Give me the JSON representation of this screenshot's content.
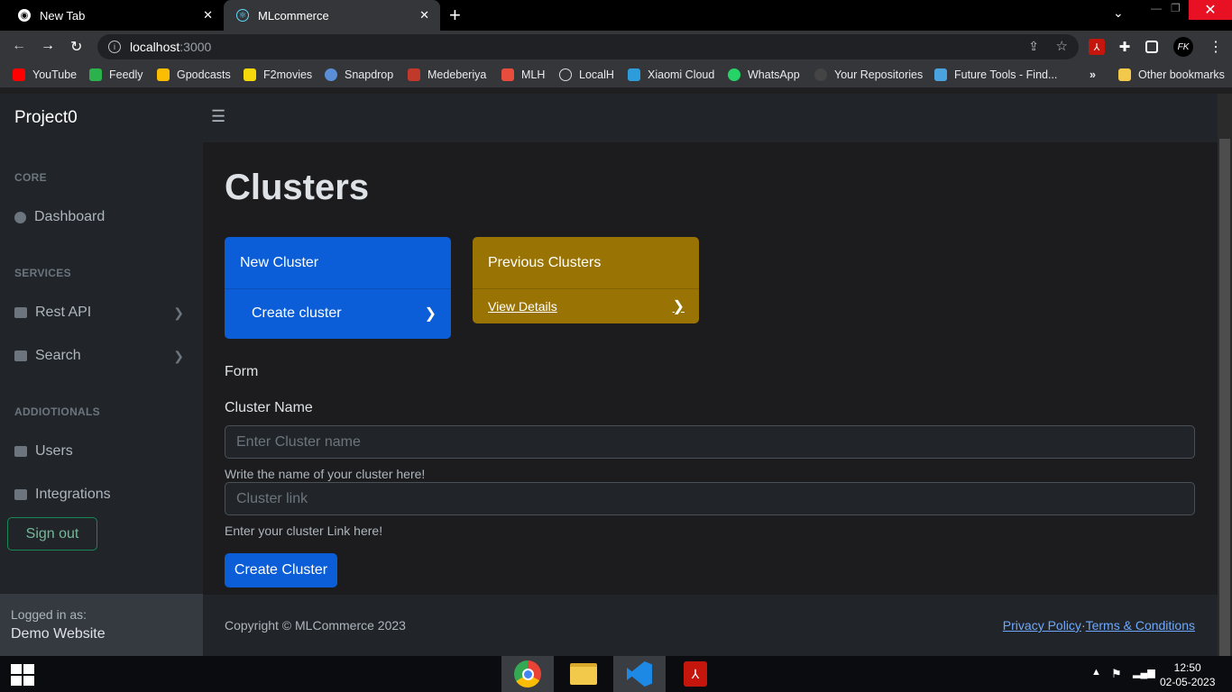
{
  "browser": {
    "tabs": [
      {
        "title": "New Tab"
      },
      {
        "title": "MLcommerce"
      }
    ],
    "address": {
      "host": "localhost",
      "port": ":3000"
    },
    "bookmarks": [
      {
        "label": "YouTube",
        "color": "#ff0000"
      },
      {
        "label": "Feedly",
        "color": "#2bb24c"
      },
      {
        "label": "Gpodcasts",
        "color": "#fbbc04"
      },
      {
        "label": "F2movies",
        "color": "#f5d90a"
      },
      {
        "label": "Snapdrop",
        "color": "#5a8fd8"
      },
      {
        "label": "Medeberiya",
        "color": "#c0392b"
      },
      {
        "label": "MLH",
        "color": "#e74c3c"
      },
      {
        "label": "LocalH",
        "color": "#dddddd"
      },
      {
        "label": "Xiaomi Cloud",
        "color": "#2d9cdb"
      },
      {
        "label": "WhatsApp",
        "color": "#25d366"
      },
      {
        "label": "Your Repositories",
        "color": "#444444"
      },
      {
        "label": "Future Tools - Find...",
        "color": "#4aa3df"
      }
    ],
    "other_bookmarks": "Other bookmarks",
    "overflow": "»",
    "profile_initials": "FK"
  },
  "sidebar": {
    "brand": "Project0",
    "sections": [
      {
        "heading": "CORE",
        "items": [
          {
            "label": "Dashboard",
            "chevron": false
          }
        ]
      },
      {
        "heading": "SERVICES",
        "items": [
          {
            "label": "Rest API",
            "chevron": true
          },
          {
            "label": "Search",
            "chevron": true
          }
        ]
      },
      {
        "heading": "ADDIOTIONALS",
        "items": [
          {
            "label": "Users",
            "chevron": false
          },
          {
            "label": "Integrations",
            "chevron": false
          }
        ]
      }
    ],
    "signout": "Sign out",
    "logged_label": "Logged in as:",
    "logged_user": "Demo Website"
  },
  "main": {
    "title": "Clusters",
    "cards": [
      {
        "title": "New Cluster",
        "action": "Create cluster",
        "color": "#0b5ed7"
      },
      {
        "title": "Previous Clusters",
        "action": "View Details",
        "color": "#997404"
      }
    ],
    "form_label": "Form",
    "cluster_name_label": "Cluster Name",
    "name_placeholder": "Enter Cluster name",
    "name_help": "Write the name of your cluster here!",
    "link_placeholder": "Cluster link",
    "link_help": "Enter your cluster Link here!",
    "submit": "Create Cluster"
  },
  "footer": {
    "copyright": "Copyright © MLCommerce 2023",
    "privacy": "Privacy Policy",
    "separator": "·",
    "terms": "Terms & Conditions"
  },
  "taskbar": {
    "time": "12:50",
    "date": "02-05-2023"
  }
}
